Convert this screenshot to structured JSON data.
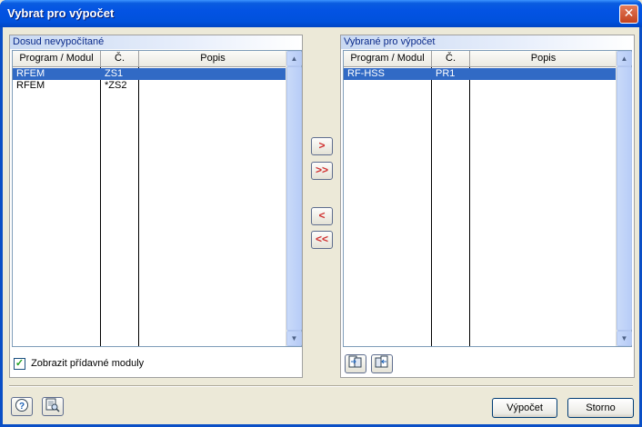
{
  "window": {
    "title": "Vybrat pro výpočet",
    "close_glyph": "✕"
  },
  "left_panel": {
    "header": "Dosud nevypočítané",
    "columns": [
      "Program / Modul",
      "Č.",
      "Popis"
    ],
    "rows": [
      {
        "program": "RFEM",
        "number": "ZS1",
        "description": "",
        "selected": true
      },
      {
        "program": "RFEM",
        "number": "*ZS2",
        "description": "",
        "selected": false
      }
    ],
    "show_addon_checkbox": {
      "label": "Zobrazit přídavné moduly",
      "checked": true
    }
  },
  "right_panel": {
    "header": "Vybrané pro výpočet",
    "columns": [
      "Program / Modul",
      "Č.",
      "Popis"
    ],
    "rows": [
      {
        "program": "RF-HSS",
        "number": "PR1",
        "description": "",
        "selected": true
      }
    ]
  },
  "transfer_buttons": {
    "add_one": ">",
    "add_all": ">>",
    "remove_one": "<",
    "remove_all": "<<"
  },
  "footer": {
    "calculate_label": "Výpočet",
    "cancel_label": "Storno"
  },
  "icons": {
    "help": "help-icon",
    "details": "search-details-icon",
    "import": "import-list-icon",
    "export": "export-list-icon"
  },
  "colors": {
    "selection": "#316ac5",
    "title_bar": "#0353e3",
    "arrow": "#d03030"
  }
}
